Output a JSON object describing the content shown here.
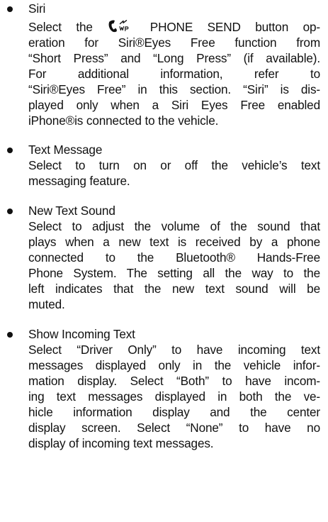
{
  "items": [
    {
      "title": "Siri",
      "lines": [
        {
          "before_icon": "Select the ",
          "icon": "phone-send-icon",
          "after_icon": " PHONE SEND button op-"
        },
        "eration for Siri®Eyes Free function from",
        "“Short Press” and “Long Press” (if available).",
        "For additional information, refer to",
        "“Siri®Eyes Free” in this section. “Siri” is dis-",
        "played only when a Siri Eyes Free enabled",
        "iPhone®is connected to the vehicle."
      ]
    },
    {
      "title": "Text Message",
      "lines": [
        "Select to turn on or off the vehicle’s text",
        "messaging feature."
      ]
    },
    {
      "title": "New Text Sound",
      "lines": [
        "Select to adjust the volume of the sound that",
        "plays when a new text is received by a phone",
        "connected to the Bluetooth® Hands-Free",
        "Phone System. The setting all the way to the",
        "left indicates that the new text sound will be",
        "muted."
      ]
    },
    {
      "title": "Show Incoming Text",
      "lines": [
        "Select “Driver Only” to have incoming text",
        "messages displayed only in the vehicle infor-",
        "mation display. Select “Both” to have incom-",
        "ing text messages displayed in both the ve-",
        "hicle information display and the center",
        "display screen. Select “None” to have no",
        "display of incoming text messages."
      ]
    }
  ]
}
